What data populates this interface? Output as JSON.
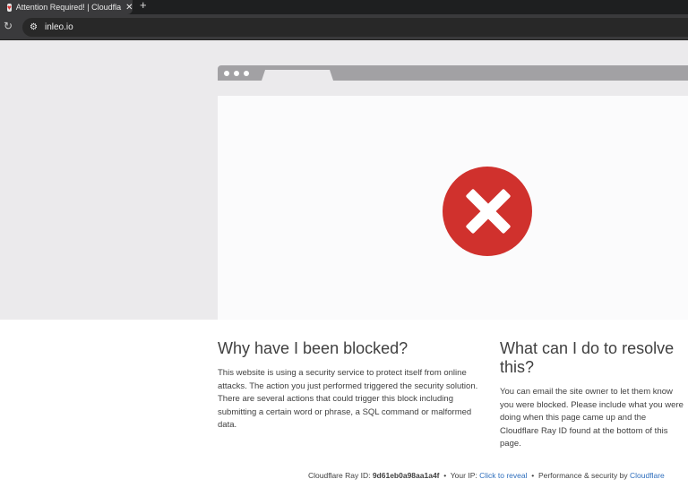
{
  "browser": {
    "tab_title": "Attention Required! | Cloudfla",
    "url": "inleo.io"
  },
  "left": {
    "heading": "Why have I been blocked?",
    "body": "This website is using a security service to protect itself from online attacks. The action you just performed triggered the security solution. There are several actions that could trigger this block including submitting a certain word or phrase, a SQL command or malformed data."
  },
  "right": {
    "heading": "What can I do to resolve this?",
    "body": "You can email the site owner to let them know you were blocked. Please include what you were doing when this page came up and the Cloudflare Ray ID found at the bottom of this page."
  },
  "footer": {
    "ray_label": "Cloudflare Ray ID:",
    "ray_id": "9d61eb0a98aa1a4f",
    "sep": "•",
    "ip_label": "Your IP:",
    "ip_link": "Click to reveal",
    "perf_label": "Performance & security by",
    "cf_link": "Cloudflare"
  }
}
